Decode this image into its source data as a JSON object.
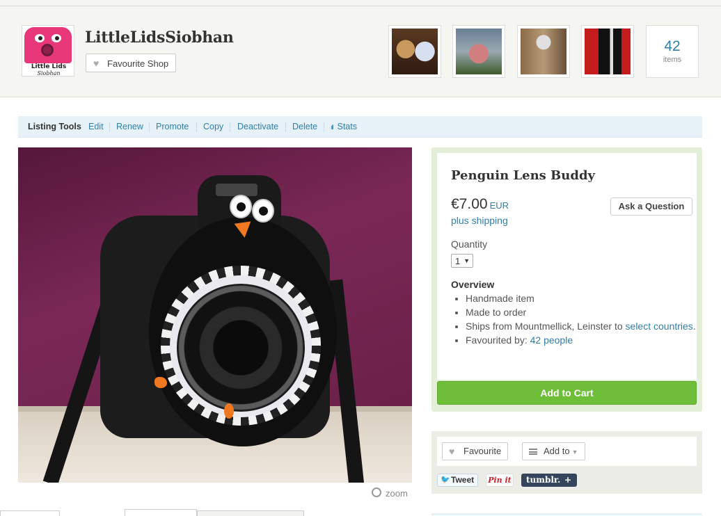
{
  "shop": {
    "name": "LittleLidsSiobhan",
    "logo_text_1": "Little Lids",
    "logo_text_2": "Siobhan",
    "favourite_label": "Favourite Shop",
    "items_count": "42",
    "items_label": "items"
  },
  "listing_tools": {
    "title": "Listing Tools",
    "links": [
      "Edit",
      "Renew",
      "Promote",
      "Copy",
      "Deactivate",
      "Delete",
      "Stats"
    ]
  },
  "product": {
    "title": "Penguin Lens Buddy",
    "price": "€7.00",
    "currency": "EUR",
    "shipping": "plus shipping",
    "ask_label": "Ask a Question",
    "quantity_label": "Quantity",
    "quantity_value": "1",
    "overview_title": "Overview",
    "overview": {
      "item1": "Handmade item",
      "item2": "Made to order",
      "item3_prefix": "Ships from Mountmellick, Leinster to ",
      "item3_link": "select countries",
      "item3_suffix": ".",
      "item4_prefix": "Favourited by: ",
      "item4_link": "42 people"
    },
    "add_to_cart": "Add to Cart",
    "zoom_label": "zoom"
  },
  "social": {
    "favourite_label": "Favourite",
    "add_to_label": "Add to",
    "tweet_label": "Tweet",
    "pin_label": "Pin it",
    "tumblr_label": "tumblr.",
    "tumblr_plus": "+"
  },
  "colors": {
    "link": "#2f7ea6",
    "cart_button": "#6fbe3a",
    "logo_pink": "#e8387a"
  }
}
